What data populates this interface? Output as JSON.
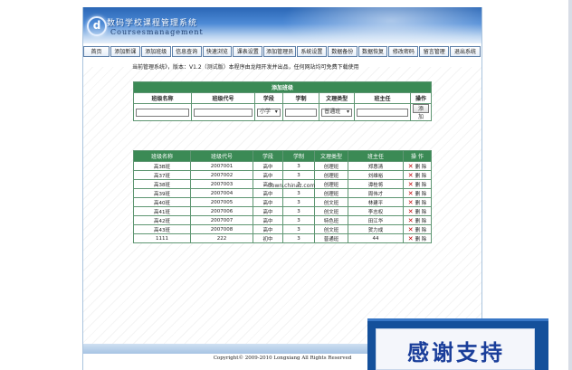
{
  "header": {
    "logo_letter": "d",
    "title": "数码学校课程管理系统",
    "subtitle": "Coursesmanagement"
  },
  "nav": [
    "首页",
    "添加新课",
    "添加班级",
    "信息查询",
    "快速浏览",
    "课表设置",
    "添加管理员",
    "系统设置",
    "数据备份",
    "数据恢复",
    "修改密码",
    "留言管理",
    "退出系统"
  ],
  "notice": "当前管理系统》，版本：V1.2（测试版）本程序由龙翔开发并出品，任何网站均可免费下载使用",
  "add_form": {
    "caption": "添加班级",
    "headers": [
      "班级名称",
      "班级代号",
      "学段",
      "学制",
      "文理类型",
      "班主任",
      "操作"
    ],
    "stage_value": "小学",
    "type_value": "普通班",
    "add_button": "添加"
  },
  "class_table": {
    "headers": [
      "班级名称",
      "班级代号",
      "学段",
      "学制",
      "文理类型",
      "班主任",
      "操 作"
    ],
    "rows": [
      [
        "高3B班",
        "2007001",
        "高中",
        "3",
        "创理班",
        "郑惠清"
      ],
      [
        "高37班",
        "2007002",
        "高中",
        "3",
        "创理班",
        "刘维裕"
      ],
      [
        "高38班",
        "2007003",
        "高中",
        "3",
        "创理班",
        "谭桂将"
      ],
      [
        "高39班",
        "2007004",
        "高中",
        "3",
        "创理班",
        "周伟才"
      ],
      [
        "高40班",
        "2007005",
        "高中",
        "3",
        "创文班",
        "林建平"
      ],
      [
        "高41班",
        "2007006",
        "高中",
        "3",
        "创文班",
        "李志权"
      ],
      [
        "高42班",
        "2007007",
        "高中",
        "3",
        "特色班",
        "田江华"
      ],
      [
        "高43班",
        "2007008",
        "高中",
        "3",
        "创文班",
        "贺力成"
      ],
      [
        "1111",
        "222",
        "初中",
        "3",
        "普通班",
        "44"
      ]
    ],
    "delete_label": "删 除"
  },
  "site_mark": "down.chinaz.com",
  "copyright": "Copyright© 2009-2010 Longxiang All Rights Reserved",
  "promo_text": "感谢支持"
}
